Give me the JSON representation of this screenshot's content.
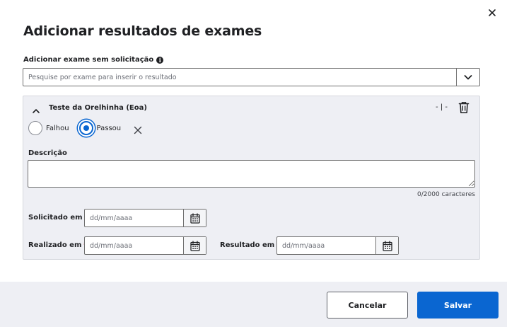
{
  "dialog": {
    "title": "Adicionar resultados de exames"
  },
  "search": {
    "label": "Adicionar exame sem solicitação",
    "placeholder": "Pesquise por exame para inserir o resultado"
  },
  "exam": {
    "name": "Teste da Orelhinha (Eoa)",
    "reference_range": "- | -",
    "options": [
      {
        "label": "Falhou",
        "selected": false
      },
      {
        "label": "Passou",
        "selected": true
      }
    ],
    "description_label": "Descrição",
    "description_value": "",
    "char_count": "0/2000 caracteres",
    "requested_label": "Solicitado em",
    "performed_label": "Realizado em",
    "performed_required": "*",
    "result_label": "Resultado em",
    "date_placeholder": "dd/mm/aaaa"
  },
  "footer": {
    "cancel_label": "Cancelar",
    "save_label": "Salvar"
  },
  "colors": {
    "primary": "#0a66d1",
    "panel_bg": "#eeeff4",
    "required": "#d0021b"
  }
}
